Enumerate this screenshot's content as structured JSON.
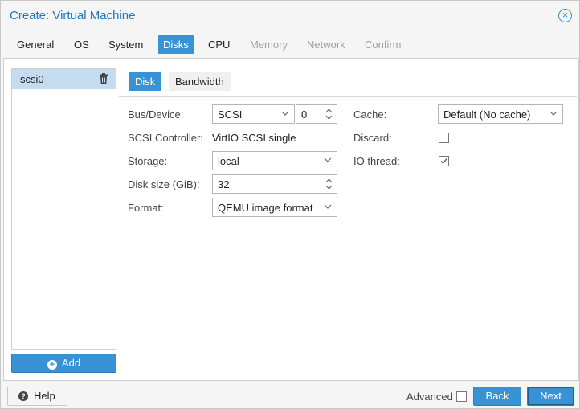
{
  "window": {
    "title": "Create: Virtual Machine"
  },
  "tabs": [
    {
      "label": "General",
      "state": "normal"
    },
    {
      "label": "OS",
      "state": "normal"
    },
    {
      "label": "System",
      "state": "normal"
    },
    {
      "label": "Disks",
      "state": "active"
    },
    {
      "label": "CPU",
      "state": "normal"
    },
    {
      "label": "Memory",
      "state": "disabled"
    },
    {
      "label": "Network",
      "state": "disabled"
    },
    {
      "label": "Confirm",
      "state": "disabled"
    }
  ],
  "disks": {
    "items": [
      {
        "label": "scsi0"
      }
    ],
    "add_label": "Add"
  },
  "subtabs": {
    "disk": "Disk",
    "bandwidth": "Bandwidth"
  },
  "form": {
    "bus_device": {
      "label": "Bus/Device:",
      "bus": "SCSI",
      "device": "0"
    },
    "scsi_controller": {
      "label": "SCSI Controller:",
      "value": "VirtIO SCSI single"
    },
    "storage": {
      "label": "Storage:",
      "value": "local"
    },
    "disk_size": {
      "label": "Disk size (GiB):",
      "value": "32"
    },
    "format": {
      "label": "Format:",
      "value": "QEMU image format"
    },
    "cache": {
      "label": "Cache:",
      "value": "Default (No cache)"
    },
    "discard": {
      "label": "Discard:",
      "checked": false
    },
    "io_thread": {
      "label": "IO thread:",
      "checked": true
    }
  },
  "footer": {
    "help": "Help",
    "advanced": "Advanced",
    "advanced_checked": false,
    "back": "Back",
    "next": "Next"
  },
  "colors": {
    "accent": "#3892d4",
    "title": "#1c75bc",
    "selected_row": "#c5dcf0"
  },
  "icons": [
    "close-icon",
    "trash-icon",
    "plus-circle-icon",
    "chevron-down-icon",
    "spinner-icon",
    "question-icon",
    "check-icon"
  ]
}
